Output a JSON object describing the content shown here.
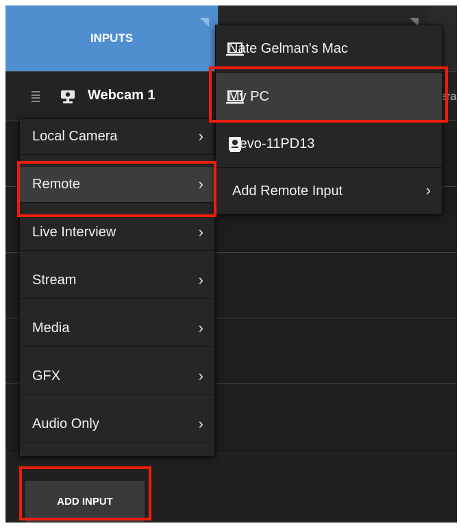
{
  "header": {
    "inputs_tab_label": "INPUTS",
    "accent_color": "#4f8fd0"
  },
  "input_list": {
    "rows": [
      {
        "title": "Webcam 1",
        "icon": "webcam-icon",
        "trailing_text": "era"
      }
    ]
  },
  "add_menu": {
    "items": [
      {
        "label": "Local Camera",
        "icon": "chevron-right-icon"
      },
      {
        "label": "Remote",
        "icon": "chevron-right-icon",
        "selected": true
      },
      {
        "label": "Live Interview",
        "icon": "chevron-right-icon"
      },
      {
        "label": "Stream",
        "icon": "chevron-right-icon"
      },
      {
        "label": "Media",
        "icon": "chevron-right-icon"
      },
      {
        "label": "GFX",
        "icon": "chevron-right-icon"
      },
      {
        "label": "Audio Only",
        "icon": "chevron-right-icon"
      }
    ],
    "chevron": "›"
  },
  "remote_submenu": {
    "items": [
      {
        "label": "Nate Gelman's Mac",
        "icon": "laptop-icon"
      },
      {
        "label": "My PC",
        "icon": "laptop-icon",
        "selected": true
      },
      {
        "label": "Mevo-11PD13",
        "icon": "mevo-camera-icon"
      },
      {
        "label": "Add Remote Input",
        "icon": "chevron-right-icon"
      }
    ]
  },
  "bottom_bar": {
    "add_input_label": "ADD INPUT"
  },
  "annotation_color": "#ee1c0c"
}
